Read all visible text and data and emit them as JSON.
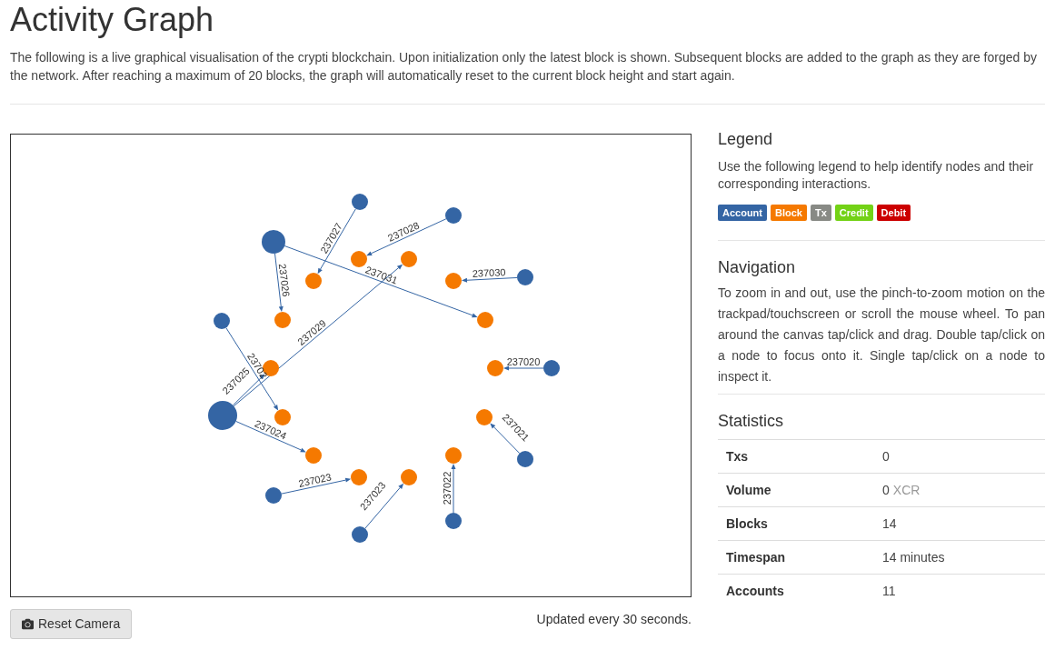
{
  "page": {
    "title": "Activity Graph",
    "intro": "The following is a live graphical visualisation of the crypti blockchain. Upon initialization only the latest block is shown. Subsequent blocks are added to the graph as they are forged by the network. After reaching a maximum of 20 blocks, the graph will automatically reset to the current block height and start again."
  },
  "graph": {
    "nodes": [
      {
        "kind": "account"
      },
      {
        "kind": "account"
      },
      {
        "kind": "account"
      },
      {
        "kind": "block"
      },
      {
        "kind": "block"
      },
      {
        "kind": "account"
      },
      {
        "kind": "block"
      },
      {
        "kind": "block"
      },
      {
        "kind": "account"
      },
      {
        "kind": "block"
      },
      {
        "kind": "block"
      },
      {
        "kind": "block"
      },
      {
        "kind": "block"
      },
      {
        "kind": "account"
      },
      {
        "kind": "account"
      },
      {
        "kind": "block"
      },
      {
        "kind": "block"
      },
      {
        "kind": "block"
      },
      {
        "kind": "block"
      },
      {
        "kind": "account"
      },
      {
        "kind": "block"
      },
      {
        "kind": "block"
      },
      {
        "kind": "account"
      },
      {
        "kind": "account"
      },
      {
        "kind": "account"
      }
    ],
    "edges": [
      {
        "label": "237027"
      },
      {
        "label": "237028"
      },
      {
        "label": "237026"
      },
      {
        "label": "237031"
      },
      {
        "label": "237030"
      },
      {
        "label": "237029"
      },
      {
        "label": "23702"
      },
      {
        "label": "237020"
      },
      {
        "label": "237025"
      },
      {
        "label": "237024"
      },
      {
        "label": "237021"
      },
      {
        "label": "237023"
      },
      {
        "label": "237023"
      },
      {
        "label": "237022"
      }
    ]
  },
  "reset_button": {
    "label": "Reset Camera"
  },
  "update_note": "Updated every 30 seconds.",
  "legend": {
    "title": "Legend",
    "text": "Use the following legend to help identify nodes and their corresponding interactions.",
    "items": [
      {
        "label": "Account",
        "color": "#3465a4"
      },
      {
        "label": "Block",
        "color": "#f57900"
      },
      {
        "label": "Tx",
        "color": "#888a85"
      },
      {
        "label": "Credit",
        "color": "#73d216"
      },
      {
        "label": "Debit",
        "color": "#cc0000"
      }
    ]
  },
  "navigation": {
    "title": "Navigation",
    "text": "To zoom in and out, use the pinch-to-zoom motion on the trackpad/touchscreen or scroll the mouse wheel. To pan around the canvas tap/click and drag. Double tap/click on a node to focus onto it. Single tap/click on a node to inspect it."
  },
  "statistics": {
    "title": "Statistics",
    "rows": [
      {
        "label": "Txs",
        "value": "0"
      },
      {
        "label": "Volume",
        "value": "0",
        "unit": "XCR"
      },
      {
        "label": "Blocks",
        "value": "14"
      },
      {
        "label": "Timespan",
        "value": "14 minutes"
      },
      {
        "label": "Accounts",
        "value": "11"
      }
    ]
  }
}
